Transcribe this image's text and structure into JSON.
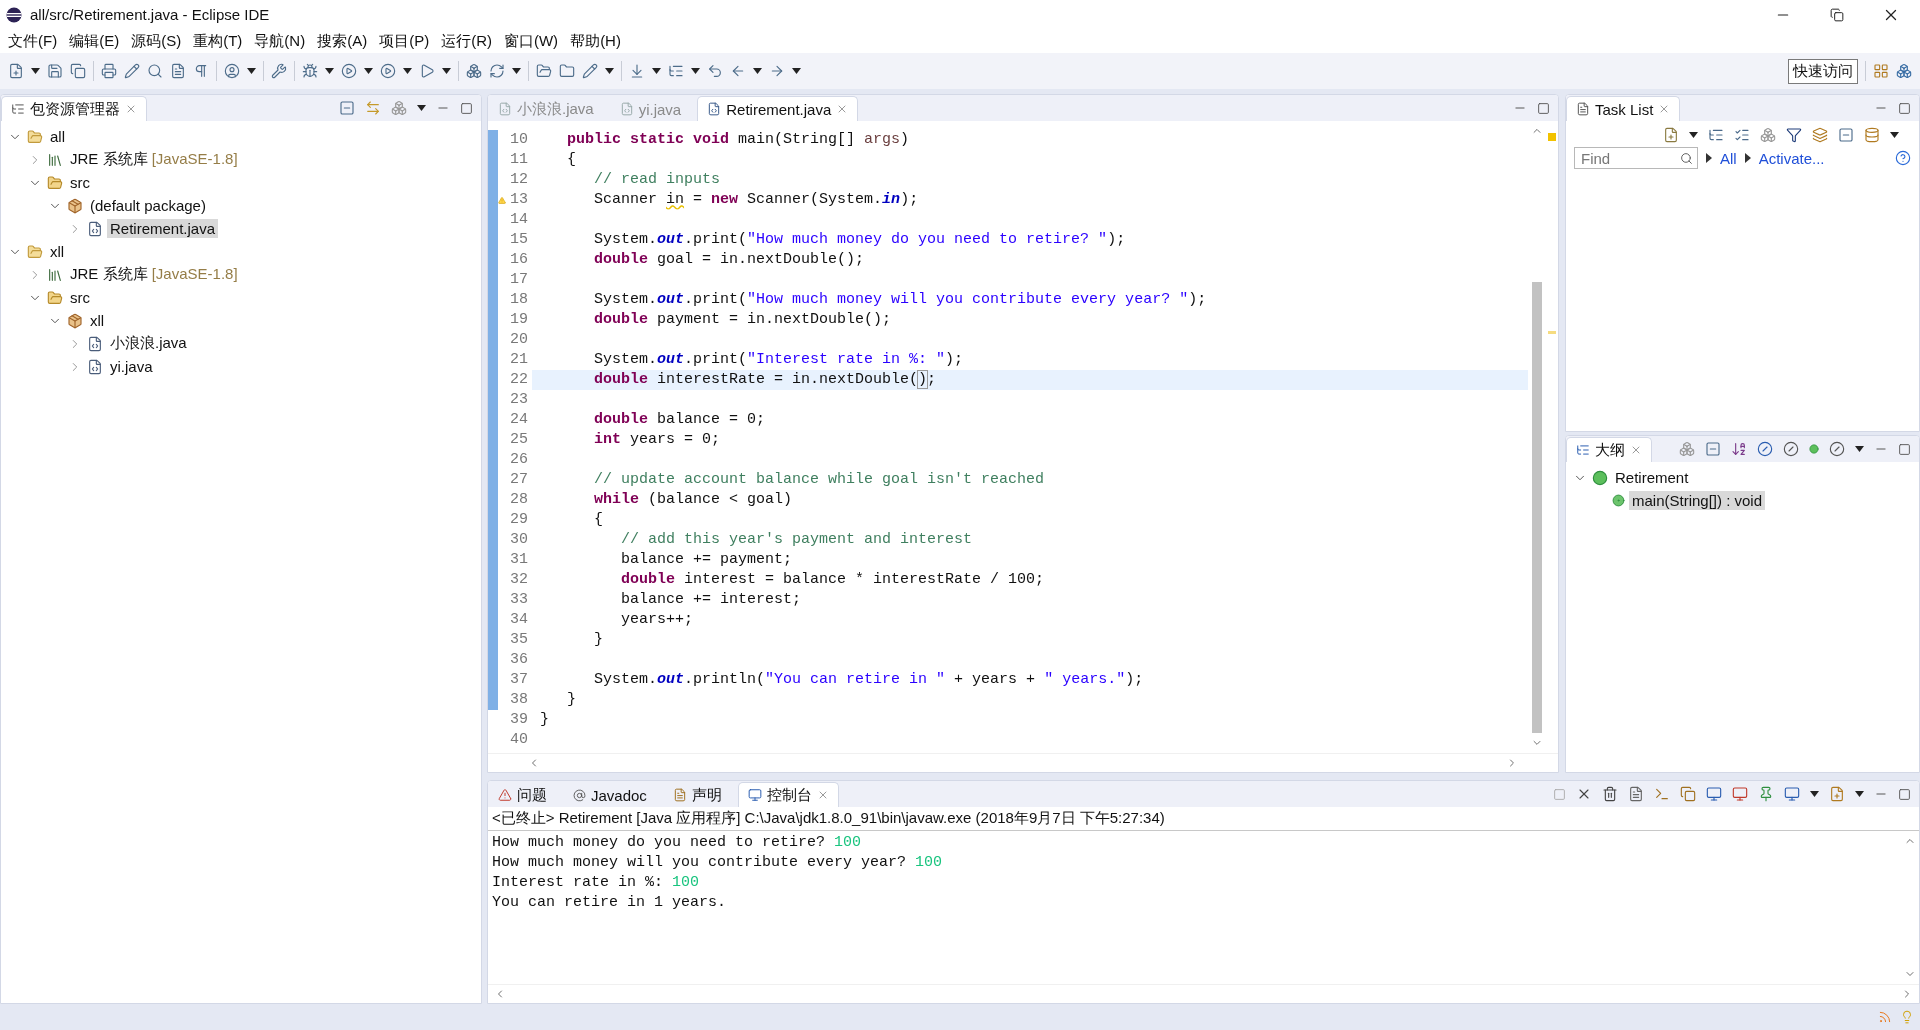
{
  "window": {
    "title": "all/src/Retirement.java - Eclipse IDE"
  },
  "menu": [
    "文件(F)",
    "编辑(E)",
    "源码(S)",
    "重构(T)",
    "导航(N)",
    "搜索(A)",
    "项目(P)",
    "运行(R)",
    "窗口(W)",
    "帮助(H)"
  ],
  "quick_access": "快速访问",
  "package_explorer": {
    "title": "包资源管理器",
    "tree": [
      {
        "label": "all",
        "kind": "project",
        "expanded": true,
        "selected": false,
        "children": [
          {
            "label": "JRE 系统库",
            "detail": "[JavaSE-1.8]",
            "kind": "library",
            "expanded": false,
            "selected": false
          },
          {
            "label": "src",
            "kind": "source",
            "expanded": true,
            "selected": false,
            "children": [
              {
                "label": "(default package)",
                "kind": "package",
                "expanded": true,
                "selected": false,
                "children": [
                  {
                    "label": "Retirement.java",
                    "kind": "file",
                    "expanded": false,
                    "selected": true
                  }
                ]
              }
            ]
          }
        ]
      },
      {
        "label": "xll",
        "kind": "project",
        "expanded": true,
        "selected": false,
        "children": [
          {
            "label": "JRE 系统库",
            "detail": "[JavaSE-1.8]",
            "kind": "library",
            "expanded": false,
            "selected": false
          },
          {
            "label": "src",
            "kind": "source",
            "expanded": true,
            "selected": false,
            "children": [
              {
                "label": "xll",
                "kind": "package",
                "expanded": true,
                "selected": false,
                "children": [
                  {
                    "label": "小浪浪.java",
                    "kind": "file",
                    "expanded": false,
                    "selected": false
                  },
                  {
                    "label": "yi.java",
                    "kind": "file",
                    "expanded": false,
                    "selected": false
                  }
                ]
              }
            ]
          }
        ]
      }
    ]
  },
  "editor": {
    "tabs": [
      {
        "label": "小浪浪.java",
        "selected": false
      },
      {
        "label": "yi.java",
        "selected": false
      },
      {
        "label": "Retirement.java",
        "selected": true
      }
    ],
    "lines": [
      {
        "number": "10",
        "changed": true,
        "warning": false,
        "current": false,
        "tokens": [
          {
            "kind": "kw",
            "text": "   public static void"
          },
          {
            "kind": "txt",
            "text": " main(String[] "
          },
          {
            "kind": "param",
            "text": "args"
          },
          {
            "kind": "txt",
            "text": ")"
          }
        ]
      },
      {
        "number": "11",
        "changed": true,
        "warning": false,
        "current": false,
        "tokens": [
          {
            "kind": "txt",
            "text": "   {"
          }
        ]
      },
      {
        "number": "12",
        "changed": true,
        "warning": false,
        "current": false,
        "tokens": [
          {
            "kind": "cmt",
            "text": "      // read inputs"
          }
        ]
      },
      {
        "number": "13",
        "changed": true,
        "warning": true,
        "current": false,
        "tokens": [
          {
            "kind": "txt",
            "text": "      Scanner "
          },
          {
            "kind": "warn",
            "text": "in"
          },
          {
            "kind": "txt",
            "text": " = "
          },
          {
            "kind": "kw",
            "text": "new"
          },
          {
            "kind": "txt",
            "text": " Scanner(System."
          },
          {
            "kind": "static",
            "text": "in"
          },
          {
            "kind": "txt",
            "text": ");"
          }
        ]
      },
      {
        "number": "14",
        "changed": true,
        "warning": false,
        "current": false
      },
      {
        "number": "15",
        "changed": true,
        "warning": false,
        "current": false,
        "tokens": [
          {
            "kind": "txt",
            "text": "      System."
          },
          {
            "kind": "static",
            "text": "out"
          },
          {
            "kind": "txt",
            "text": ".print("
          },
          {
            "kind": "str",
            "text": "\"How much money do you need to retire? \""
          },
          {
            "kind": "txt",
            "text": ");"
          }
        ]
      },
      {
        "number": "16",
        "changed": true,
        "warning": false,
        "current": false,
        "tokens": [
          {
            "kind": "kw",
            "text": "      double"
          },
          {
            "kind": "txt",
            "text": " goal = in.nextDouble();"
          }
        ]
      },
      {
        "number": "17",
        "changed": true,
        "warning": false,
        "current": false
      },
      {
        "number": "18",
        "changed": true,
        "warning": false,
        "current": false,
        "tokens": [
          {
            "kind": "txt",
            "text": "      System."
          },
          {
            "kind": "static",
            "text": "out"
          },
          {
            "kind": "txt",
            "text": ".print("
          },
          {
            "kind": "str",
            "text": "\"How much money will you contribute every year? \""
          },
          {
            "kind": "txt",
            "text": ");"
          }
        ]
      },
      {
        "number": "19",
        "changed": true,
        "warning": false,
        "current": false,
        "tokens": [
          {
            "kind": "kw",
            "text": "      double"
          },
          {
            "kind": "txt",
            "text": " payment = in.nextDouble();"
          }
        ]
      },
      {
        "number": "20",
        "changed": true,
        "warning": false,
        "current": false
      },
      {
        "number": "21",
        "changed": true,
        "warning": false,
        "current": false,
        "tokens": [
          {
            "kind": "txt",
            "text": "      System."
          },
          {
            "kind": "static",
            "text": "out"
          },
          {
            "kind": "txt",
            "text": ".print("
          },
          {
            "kind": "str",
            "text": "\"Interest rate in %: \""
          },
          {
            "kind": "txt",
            "text": ");"
          }
        ]
      },
      {
        "number": "22",
        "changed": true,
        "warning": false,
        "current": true,
        "tokens": [
          {
            "kind": "kw",
            "text": "      double"
          },
          {
            "kind": "txt",
            "text": " interestRate = in.nextDouble("
          },
          {
            "kind": "bracket",
            "text": ")"
          },
          {
            "kind": "txt",
            "text": ";"
          }
        ]
      },
      {
        "number": "23",
        "changed": true,
        "warning": false,
        "current": false
      },
      {
        "number": "24",
        "changed": true,
        "warning": false,
        "current": false,
        "tokens": [
          {
            "kind": "kw",
            "text": "      double"
          },
          {
            "kind": "txt",
            "text": " balance = 0;"
          }
        ]
      },
      {
        "number": "25",
        "changed": true,
        "warning": false,
        "current": false,
        "tokens": [
          {
            "kind": "kw",
            "text": "      int"
          },
          {
            "kind": "txt",
            "text": " years = 0;"
          }
        ]
      },
      {
        "number": "26",
        "changed": true,
        "warning": false,
        "current": false
      },
      {
        "number": "27",
        "changed": true,
        "warning": false,
        "current": false,
        "tokens": [
          {
            "kind": "cmt",
            "text": "      // update account balance while goal isn't reached"
          }
        ]
      },
      {
        "number": "28",
        "changed": true,
        "warning": false,
        "current": false,
        "tokens": [
          {
            "kind": "kw",
            "text": "      while"
          },
          {
            "kind": "txt",
            "text": " (balance < goal)"
          }
        ]
      },
      {
        "number": "29",
        "changed": true,
        "warning": false,
        "current": false,
        "tokens": [
          {
            "kind": "txt",
            "text": "      {"
          }
        ]
      },
      {
        "number": "30",
        "changed": true,
        "warning": false,
        "current": false,
        "tokens": [
          {
            "kind": "cmt",
            "text": "         // add this year's payment and interest"
          }
        ]
      },
      {
        "number": "31",
        "changed": true,
        "warning": false,
        "current": false,
        "tokens": [
          {
            "kind": "txt",
            "text": "         balance += payment;"
          }
        ]
      },
      {
        "number": "32",
        "changed": true,
        "warning": false,
        "current": false,
        "tokens": [
          {
            "kind": "kw",
            "text": "         double"
          },
          {
            "kind": "txt",
            "text": " interest = balance * interestRate / 100;"
          }
        ]
      },
      {
        "number": "33",
        "changed": true,
        "warning": false,
        "current": false,
        "tokens": [
          {
            "kind": "txt",
            "text": "         balance += interest;"
          }
        ]
      },
      {
        "number": "34",
        "changed": true,
        "warning": false,
        "current": false,
        "tokens": [
          {
            "kind": "txt",
            "text": "         years++;"
          }
        ]
      },
      {
        "number": "35",
        "changed": true,
        "warning": false,
        "current": false,
        "tokens": [
          {
            "kind": "txt",
            "text": "      }"
          }
        ]
      },
      {
        "number": "36",
        "changed": true,
        "warning": false,
        "current": false
      },
      {
        "number": "37",
        "changed": true,
        "warning": false,
        "current": false,
        "tokens": [
          {
            "kind": "txt",
            "text": "      System."
          },
          {
            "kind": "static",
            "text": "out"
          },
          {
            "kind": "txt",
            "text": ".println("
          },
          {
            "kind": "str",
            "text": "\"You can retire in \""
          },
          {
            "kind": "txt",
            "text": " + years + "
          },
          {
            "kind": "str",
            "text": "\" years.\""
          },
          {
            "kind": "txt",
            "text": ");"
          }
        ]
      },
      {
        "number": "38",
        "changed": true,
        "warning": false,
        "current": false,
        "tokens": [
          {
            "kind": "txt",
            "text": "   }"
          }
        ]
      },
      {
        "number": "39",
        "changed": false,
        "warning": false,
        "current": false,
        "tokens": [
          {
            "kind": "txt",
            "text": "}"
          }
        ]
      },
      {
        "number": "40",
        "changed": false,
        "warning": false,
        "current": false
      }
    ]
  },
  "task_list": {
    "title": "Task List",
    "search": {
      "placeholder": "Find"
    },
    "links": [
      "All",
      "Activate..."
    ]
  },
  "outline": {
    "title": "大纲",
    "tree": [
      {
        "label": "Retirement",
        "kind": "class",
        "expanded": true,
        "selected": false,
        "children": [
          {
            "label": "main(String[]) : void",
            "kind": "method",
            "selected": true
          }
        ]
      }
    ]
  },
  "console": {
    "tabs": [
      {
        "label": "问题",
        "kind": "problems",
        "selected": false
      },
      {
        "label": "Javadoc",
        "kind": "javadoc",
        "selected": false
      },
      {
        "label": "声明",
        "kind": "declaration",
        "selected": false
      },
      {
        "label": "控制台",
        "kind": "console",
        "selected": true
      }
    ],
    "header": "<已终止> Retirement [Java 应用程序] C:\\Java\\jdk1.8.0_91\\bin\\javaw.exe  (2018年9月7日 下午5:27:34)",
    "lines": [
      {
        "text": "How much money do you need to retire? ",
        "input": "100"
      },
      {
        "text": "How much money will you contribute every year? ",
        "input": "100"
      },
      {
        "text": "Interest rate in %: ",
        "input": "100"
      },
      {
        "text": "You can retire in 1 years."
      }
    ]
  }
}
